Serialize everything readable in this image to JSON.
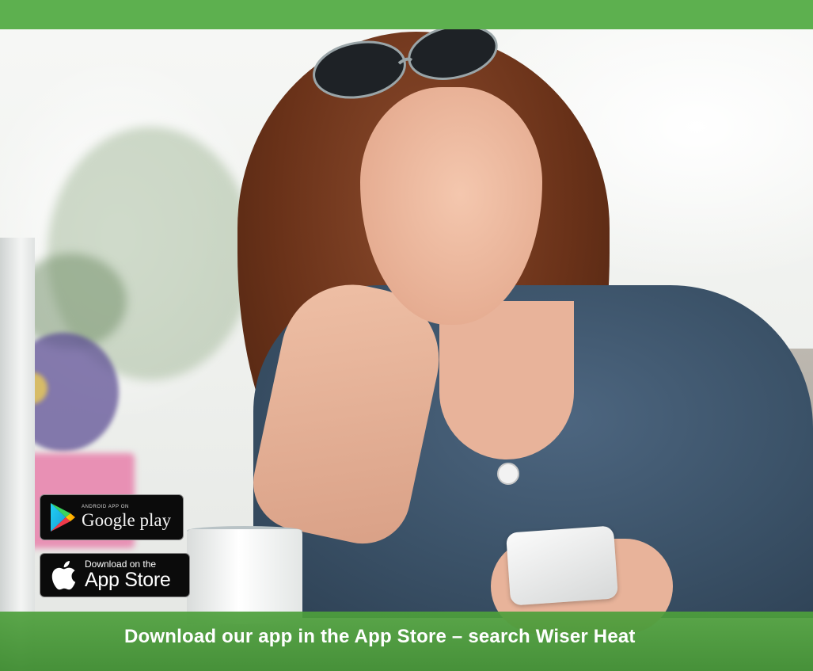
{
  "banner": {
    "text": "Download our app in the App Store – search Wiser Heat",
    "color_top_band": "#5db04f",
    "color_bottom_band": "#4ea03c"
  },
  "badges": {
    "google_play": {
      "small_text": "ANDROID APP ON",
      "big_text": "Google play",
      "icon": "google-play-icon"
    },
    "app_store": {
      "small_text": "Download on the",
      "big_text": "App Store",
      "icon": "apple-icon"
    }
  }
}
